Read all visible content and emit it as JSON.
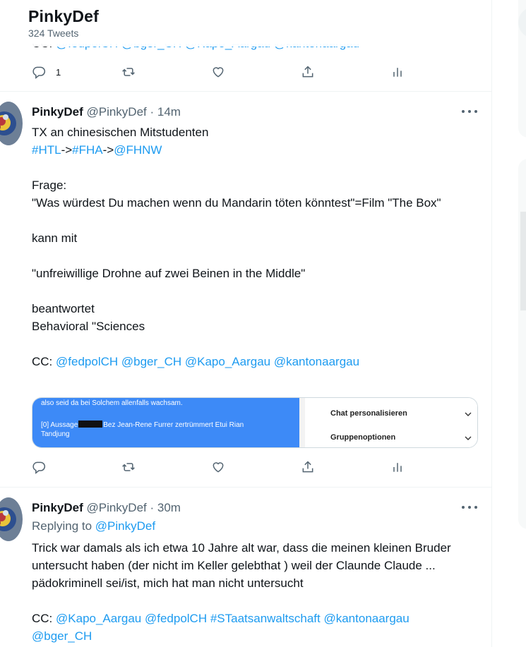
{
  "header": {
    "title": "PinkyDef",
    "subtitle": "324 Tweets"
  },
  "ghost_tweet": {
    "cc_prefix": "CC:",
    "cc_text": "@fedpolCH @bger_CH @Kapo_Aargau @kantonaargau",
    "reply_count": "1"
  },
  "tweet1": {
    "name": "PinkyDef",
    "meta": "@PinkyDef · 14m",
    "line1": "TX an chinesischen Mitstudenten",
    "hashtags": {
      "htl": "#HTL",
      "arrow1": "->",
      "fha": "#FHA",
      "arrow2": "->",
      "fhnw": "@FHNW"
    },
    "p1": "Frage:",
    "p2": "\"Was würdest Du machen wenn du Mandarin töten könntest\"=Film \"The Box\"",
    "p3": "kann mit",
    "p4": "\"unfreiwillige Drohne auf zwei Beinen in the Middle\"",
    "p5a": "beantwortet",
    "p5b": "Behavioral \"Sciences",
    "cc_prefix": "CC:",
    "cc_mentions": "@fedpolCH @bger_CH @Kapo_Aargau @kantonaargau",
    "attachment": {
      "line1": "also seid da bei Solchem allenfalls wachsam.",
      "line2a": "[0] Aussage",
      "line2b": "Bez Jean-Rene Furrer zertrümmert Etui Rian",
      "line3": "Tandjung",
      "side_item1": "Chat personalisieren",
      "side_item2": "Gruppenoptionen"
    }
  },
  "tweet2": {
    "name": "PinkyDef",
    "meta": "@PinkyDef · 30m",
    "replying_prefix": "Replying to",
    "replying_handle": "@PinkyDef",
    "body": "Trick war damals als ich etwa 10 Jahre alt war, dass die meinen kleinen Bruder untersucht haben (der nicht im Keller gelebthat ) weil der Claunde Claude ... pädokriminell sei/ist, mich hat man nicht untersucht",
    "cc_prefix": "CC:",
    "cc_mentions_line1": "@Kapo_Aargau @fedpolCH #STaatsanwaltschaft @kantonaargau",
    "cc_mentions_line2": "@bger_CH"
  },
  "icons": [
    "reply-icon",
    "retweet-icon",
    "like-icon",
    "share-icon",
    "analytics-icon",
    "more-icon",
    "chevron-down-icon"
  ],
  "colors": {
    "link": "#1d9bf0",
    "secondary_text": "#536471",
    "attachment_blue": "#3d8af7"
  }
}
